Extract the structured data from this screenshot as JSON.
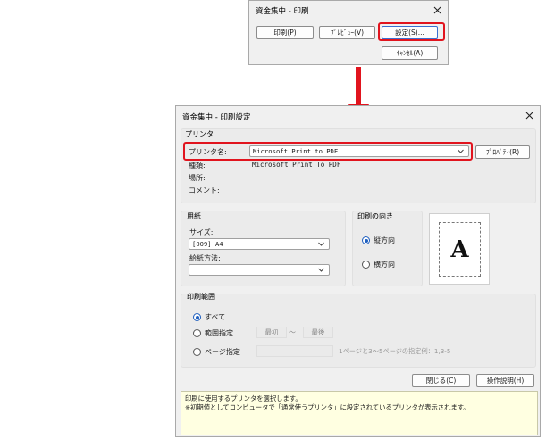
{
  "small_dialog": {
    "title": "資金集中 - 印刷",
    "buttons": {
      "print": "印刷(P)",
      "preview": "ﾌﾟﾚﾋﾞｭｰ(V)",
      "settings": "設定(S)...",
      "cancel": "ｷｬﾝｾﾙ(A)"
    }
  },
  "main_dialog": {
    "title": "資金集中 - 印刷設定",
    "printer_group": {
      "label": "プリンタ",
      "name_label": "プリンタ名:",
      "name_value": "Microsoft Print to PDF",
      "properties_button": "ﾌﾟﾛﾊﾟﾃｨ(R)",
      "type_label": "種類:",
      "type_value": "Microsoft Print To PDF",
      "location_label": "場所:",
      "comment_label": "コメント:"
    },
    "paper_group": {
      "label": "用紙",
      "size_label": "サイズ:",
      "size_value": "[009] A4",
      "feed_label": "給紙方法:",
      "feed_value": ""
    },
    "orientation_group": {
      "label": "印刷の向き",
      "portrait": "縦方向",
      "landscape": "横方向",
      "selected": "portrait",
      "preview_letter": "A"
    },
    "range_group": {
      "label": "印刷範囲",
      "all": "すべて",
      "range": "範囲指定",
      "from": "最初",
      "tilde": "～",
      "to": "最後",
      "pages": "ページ指定",
      "pages_hint": "1ページと3～5ページの指定例：1,3-5",
      "selected": "all"
    },
    "buttons": {
      "close": "閉じる(C)",
      "help": "操作説明(H)"
    },
    "help_text": {
      "line1": "印刷に使用するプリンタを選択します。",
      "line2": "※初期値としてコンピュータで「通常使うプリンタ」に設定されているプリンタが表示されます。"
    }
  },
  "colors": {
    "highlight": "#e1141e",
    "radio": "#1f5fbf",
    "help_bg": "#ffffe1"
  },
  "icons": [
    "close-icon",
    "chevron-down-icon",
    "arrow-down-icon"
  ]
}
